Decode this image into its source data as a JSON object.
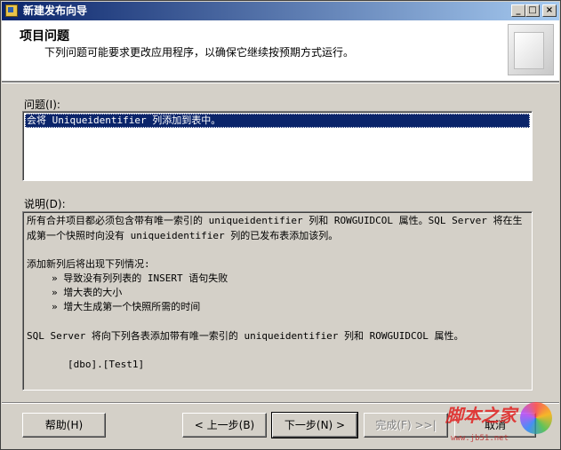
{
  "window": {
    "title": "新建发布向导"
  },
  "titlebar_buttons": {
    "minimize": "_",
    "maximize": "□",
    "close": "×"
  },
  "header": {
    "title": "项目问题",
    "subtitle": "下列问题可能要求更改应用程序，以确保它继续按预期方式运行。"
  },
  "issues": {
    "label": "问题(I):",
    "items": [
      "会将 Uniqueidentifier 列添加到表中。"
    ]
  },
  "description": {
    "label": "说明(D):",
    "lines": [
      "所有合并项目都必须包含带有唯一索引的 uniqueidentifier 列和 ROWGUIDCOL 属性。SQL Server 将在生",
      "成第一个快照时向没有 uniqueidentifier 列的已发布表添加该列。",
      "",
      "添加新列后将出现下列情况:",
      "» 导致没有列列表的 INSERT 语句失败",
      "» 增大表的大小",
      "» 增大生成第一个快照所需的时间",
      "",
      "SQL Server 将向下列各表添加带有唯一索引的 uniqueidentifier 列和 ROWGUIDCOL 属性。",
      "",
      "[dbo].[Test1]"
    ]
  },
  "buttons": {
    "help": "帮助(H)",
    "back": "< 上一步(B)",
    "next": "下一步(N) >",
    "finish": "完成(F) >>|",
    "cancel": "取消"
  },
  "watermark": {
    "text": "脚本之家",
    "url": "www.jb51.net"
  }
}
